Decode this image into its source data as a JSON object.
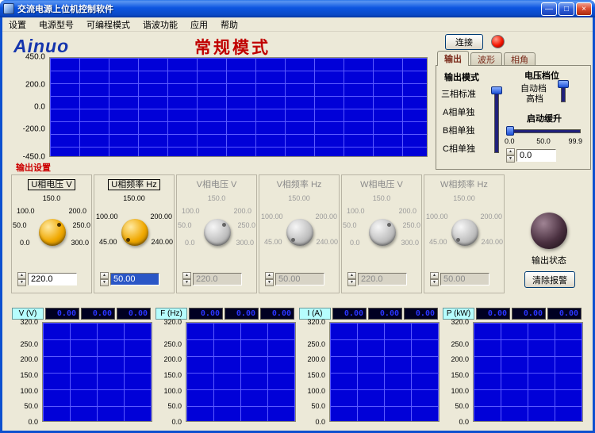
{
  "window": {
    "title": "交流电源上位机控制软件"
  },
  "icons": {
    "minimize": "—",
    "maximize": "□",
    "close": "×",
    "arrow_up": "▲",
    "arrow_down": "▼"
  },
  "menu": {
    "items": [
      "设置",
      "电源型号",
      "可编程模式",
      "谐波功能",
      "应用",
      "帮助"
    ]
  },
  "header": {
    "logo": "Ainuo",
    "mode_title": "常规模式",
    "connect_label": "连接"
  },
  "tab_panel": {
    "tabs": [
      "输出",
      "波形",
      "相角"
    ],
    "output_mode": {
      "title": "输出模式",
      "options": [
        "三相标准",
        "A相单独",
        "B相单独",
        "C相单独"
      ]
    },
    "voltage_range": {
      "title": "电压档位",
      "options": [
        "自动档",
        "高档"
      ]
    },
    "ramp": {
      "title": "启动缓升",
      "ticks": [
        "0.0",
        "50.0",
        "99.9"
      ],
      "value": "0.0"
    }
  },
  "main_chart": {
    "y_ticks": [
      "450.0",
      "200.0",
      "0.0",
      "-200.0",
      "-450.0"
    ]
  },
  "output_settings": {
    "label": "输出设置"
  },
  "knobs": [
    {
      "title": "U相电压 V",
      "value": "220.0",
      "ticks": {
        "top": "150.0",
        "ul": "100.0",
        "ur": "200.0",
        "l": "50.0",
        "r": "250.0",
        "bl": "0.0",
        "br": "300.0"
      }
    },
    {
      "title": "U相频率 Hz",
      "value": "50.00",
      "ticks": {
        "top": "150.00",
        "ul": "100.00",
        "ur": "200.00",
        "bl": "45.00",
        "br": "240.00"
      }
    },
    {
      "title": "V相电压 V",
      "value": "220.0",
      "ticks": {
        "top": "150.0",
        "ul": "100.0",
        "ur": "200.0",
        "l": "50.0",
        "r": "250.0",
        "bl": "0.0",
        "br": "300.0"
      }
    },
    {
      "title": "V相频率 Hz",
      "value": "50.00",
      "ticks": {
        "top": "150.00",
        "ul": "100.00",
        "ur": "200.00",
        "bl": "45.00",
        "br": "240.00"
      }
    },
    {
      "title": "W相电压 V",
      "value": "220.0",
      "ticks": {
        "top": "150.0",
        "ul": "100.0",
        "ur": "200.0",
        "l": "50.0",
        "r": "250.0",
        "bl": "0.0",
        "br": "300.0"
      }
    },
    {
      "title": "W相频率 Hz",
      "value": "50.00",
      "ticks": {
        "top": "150.00",
        "ul": "100.00",
        "ur": "200.00",
        "bl": "45.00",
        "br": "240.00"
      }
    }
  ],
  "status": {
    "label": "输出状态",
    "clear_button": "清除报警"
  },
  "measurements": {
    "groups": [
      {
        "label": "V (V)",
        "values": [
          "0.00",
          "0.00",
          "0.00"
        ]
      },
      {
        "label": "F (Hz)",
        "values": [
          "0.00",
          "0.00",
          "0.00"
        ]
      },
      {
        "label": "I (A)",
        "values": [
          "0.00",
          "0.00",
          "0.00"
        ]
      },
      {
        "label": "P (kW)",
        "values": [
          "0.00",
          "0.00",
          "0.00"
        ]
      }
    ]
  },
  "bottom_chart": {
    "y_ticks": [
      "320.0",
      "250.0",
      "200.0",
      "150.0",
      "100.0",
      "50.0",
      "0.0"
    ]
  },
  "colors": {
    "accent_red": "#c00000",
    "chart_bg": "#0101d8",
    "led_red": "#f51500",
    "logo_blue": "#1535ad"
  }
}
